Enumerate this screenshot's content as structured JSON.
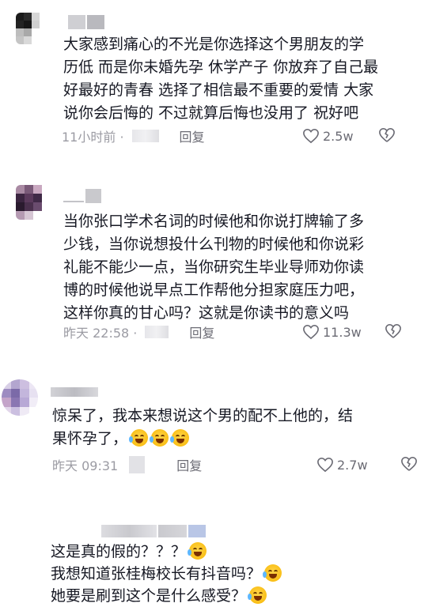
{
  "comments": [
    {
      "text": "大家感到痛心的不光是你选择这个男朋友的学\n历低 而是你未婚先孕 休学产子 你放弃了自己最\n好最好的青春 选择了相信最不重要的爱情 大家\n说你会后悔的 不过就算后悔也没用了 祝好吧",
      "time": "11小时前 ·",
      "reply": "回复",
      "likes": "2.5w"
    },
    {
      "text": "当你张口学术名词的时候他和你说打牌输了多\n少钱，当你说想投什么刊物的时候他和你说彩\n礼能不能少一点，当你研究生毕业导师劝你读\n博的时候他说早点工作帮他分担家庭压力吧，\n这样你真的甘心吗？这就是你读书的意义吗",
      "time": "昨天 22:58 ·",
      "reply": "回复",
      "likes": "11.3w"
    },
    {
      "text": "惊呆了，我本来想说这个男的配不上他的，结\n果怀孕了，",
      "time": "昨天 09:31",
      "reply": "回复",
      "likes": "2.7w",
      "emoji_icon": "crying-face-icon"
    },
    {
      "lines": [
        "这是真的假的？？？",
        "我想知道张桂梅校长有抖音吗？",
        "她要是刷到这个是什么感受？"
      ],
      "emoji_icon": "laughing-tears-icon"
    }
  ],
  "icons": {
    "like": "heart-outline-icon",
    "dislike": "broken-heart-icon"
  },
  "colors": {
    "text": "#161823",
    "meta": "#9b9ba3",
    "emoji": "#f7b500"
  }
}
